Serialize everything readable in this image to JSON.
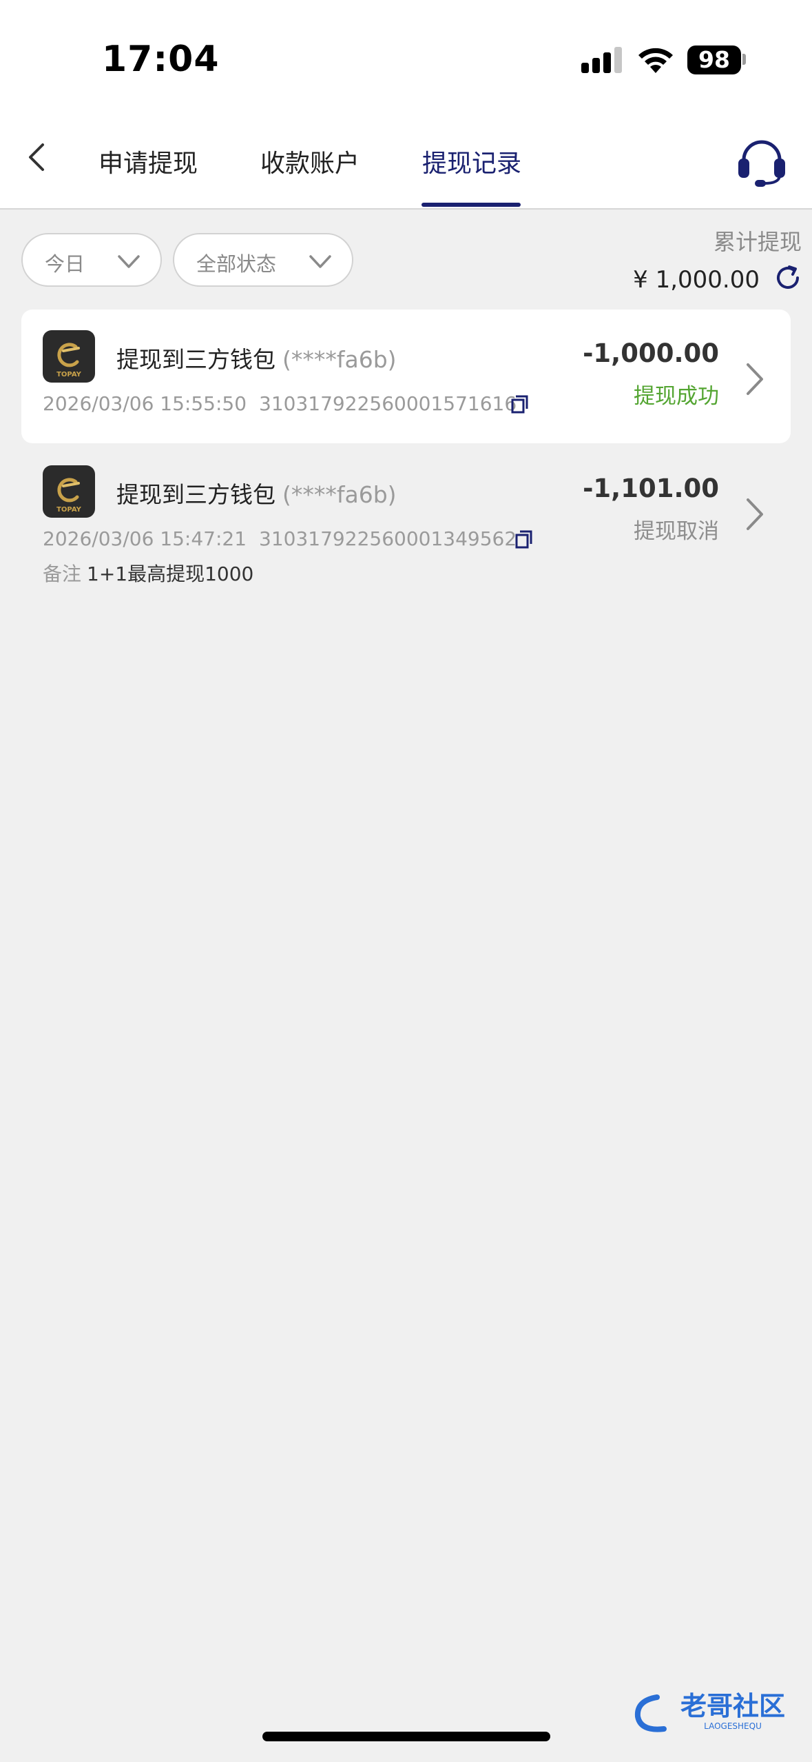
{
  "status_bar": {
    "time": "17:04",
    "battery": "98",
    "icons": [
      "signal-icon",
      "wifi-icon",
      "battery-icon"
    ]
  },
  "nav": {
    "back_icon": "chevron-left-icon",
    "tabs": [
      {
        "label": "申请提现",
        "active": false
      },
      {
        "label": "收款账户",
        "active": false
      },
      {
        "label": "提现记录",
        "active": true
      }
    ],
    "support_icon": "headset-icon",
    "accent_color": "#1a2170"
  },
  "filters": {
    "date": "今日",
    "status": "全部状态"
  },
  "summary": {
    "label": "累计提现",
    "amount": "¥ 1,000.00",
    "refresh_icon": "refresh-icon"
  },
  "records": [
    {
      "logo_text": "TOPAY",
      "title": "提现到三方钱包",
      "account": "(****fa6b)",
      "datetime": "2026/03/06 15:55:50",
      "order_no": "310317922560001571616",
      "amount": "-1,000.00",
      "status": "提现成功",
      "status_color": "#54a532"
    },
    {
      "logo_text": "TOPAY",
      "title": "提现到三方钱包",
      "account": "(****fa6b)",
      "datetime": "2026/03/06 15:47:21",
      "order_no": "310317922560001349562",
      "amount": "-1,101.00",
      "status": "提现取消",
      "status_color": "#8e8e8e",
      "remark_label": "备注",
      "remark": "1+1最高提现1000"
    }
  ],
  "watermark": {
    "text": "老哥社区",
    "subtext": "LAOGESHEQU"
  }
}
